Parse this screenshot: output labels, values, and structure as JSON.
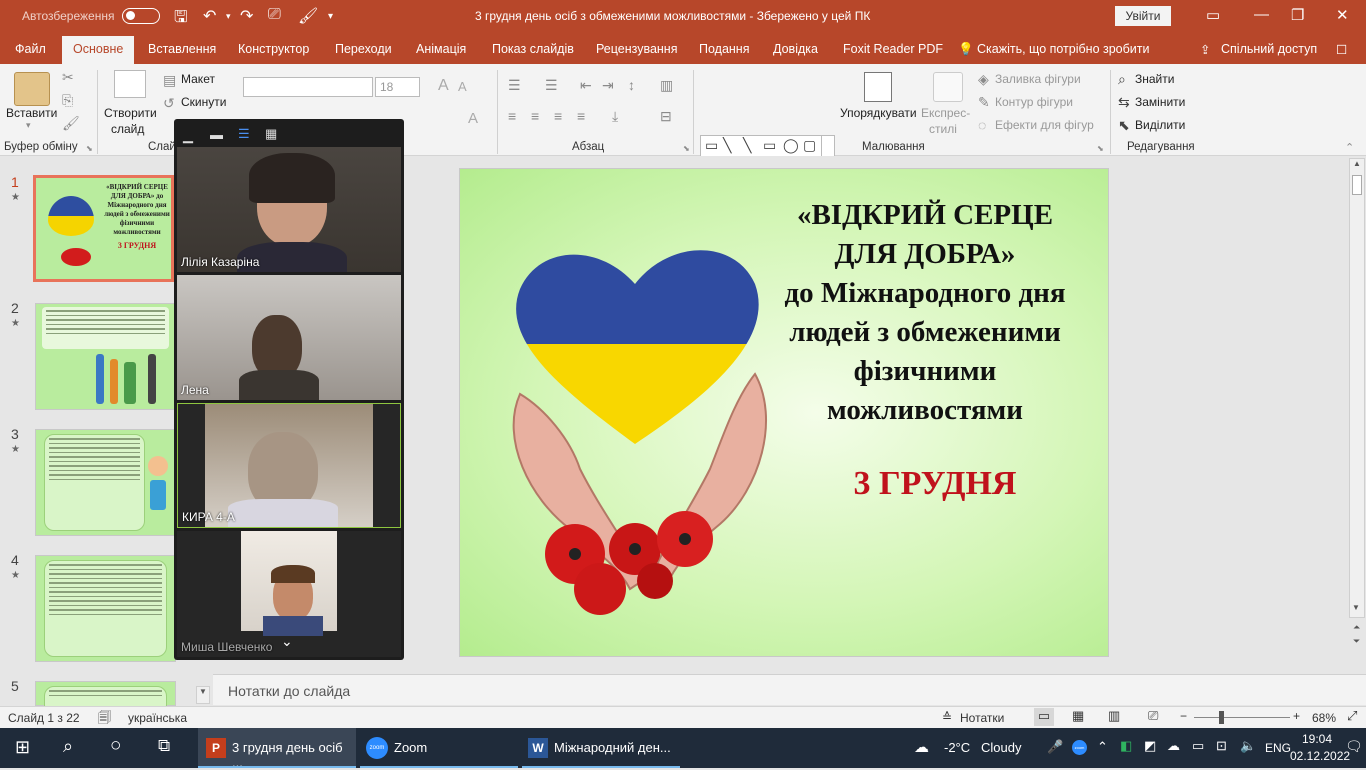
{
  "titlebar": {
    "autosave_label": "Автозбереження",
    "title": "3 грудня день осіб з обмеженими можливостями  -  Збережено у цей ПК",
    "sign_in": "Увійти"
  },
  "tabs": [
    "Файл",
    "Основне",
    "Вставлення",
    "Конструктор",
    "Переходи",
    "Анімація",
    "Показ слайдів",
    "Рецензування",
    "Подання",
    "Довідка",
    "Foxit Reader PDF"
  ],
  "tell_me": "Скажіть, що потрібно зробити",
  "share": "Спільний доступ",
  "ribbon": {
    "paste": "Вставити",
    "clipboard_group": "Буфер обміну",
    "new_slide_1": "Створити",
    "new_slide_2": "слайд",
    "layout": "Макет",
    "reset": "Скинути",
    "slides_group": "Слай",
    "font_size": "18",
    "paragraph_group": "Абзац",
    "arrange": "Упорядкувати",
    "quick_styles_1": "Експрес-",
    "quick_styles_2": "стилі",
    "shape_fill": "Заливка фігури",
    "shape_outline": "Контур фігури",
    "shape_effects": "Ефекти для фігур",
    "drawing_group": "Малювання",
    "find": "Знайти",
    "replace": "Замінити",
    "select": "Виділити",
    "editing_group": "Редагування"
  },
  "slide": {
    "title_lines": [
      "«ВІДКРИЙ СЕРЦЕ",
      "ДЛЯ ДОБРА»",
      "до Міжнародного дня",
      "людей з обмеженими",
      "фізичними",
      "можливостями"
    ],
    "date": "3 ГРУДНЯ"
  },
  "thumbnails": {
    "numbers": [
      "1",
      "2",
      "3",
      "4",
      "5"
    ],
    "thumb1_title": "«ВІДКРИЙ СЕРЦЕ ДЛЯ ДОБРА» до Міжнародного дня людей з обмеженими фізичними можливостями",
    "thumb1_date": "3 ГРУДНЯ"
  },
  "zoom": {
    "participants": [
      "Лілія Казаріна",
      "Лена",
      "КИРА 4-А",
      "Миша Шевченко"
    ]
  },
  "notes_placeholder": "Нотатки до слайда",
  "status": {
    "slide_of": "Слайд 1 з 22",
    "language": "українська",
    "notes": "Нотатки",
    "zoom_pct": "68%"
  },
  "taskbar": {
    "ppt": "3 грудня день осіб ...",
    "zoom": "Zoom",
    "word": "Міжнародний ден...",
    "weather_temp": "-2°C",
    "weather_text": "Cloudy",
    "lang": "ENG",
    "time": "19:04",
    "date": "02.12.2022"
  },
  "colors": {
    "accent": "#b7472a",
    "slide_green": "#c5f0a5",
    "date_red": "#c0121c"
  }
}
